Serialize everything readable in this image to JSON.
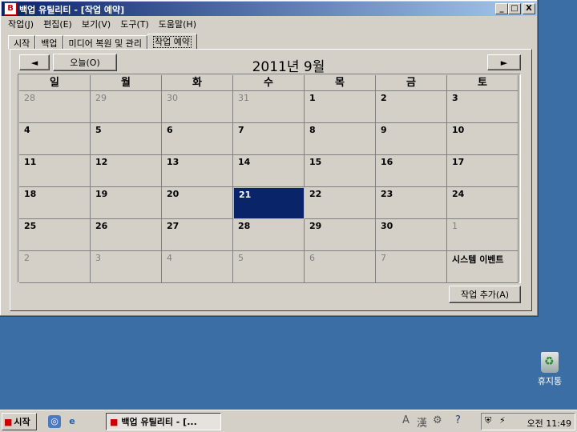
{
  "window": {
    "title": "백업 유틸리티 - [작업 예약]",
    "app_icon_glyph": "B",
    "controls": {
      "minimize": "_",
      "maximize": "□",
      "close": "X"
    }
  },
  "menu": [
    "작업(J)",
    "편집(E)",
    "보기(V)",
    "도구(T)",
    "도움말(H)"
  ],
  "tabs": [
    {
      "label": "시작"
    },
    {
      "label": "백업"
    },
    {
      "label": "미디어 복원 및 관리"
    },
    {
      "label": "작업 예약",
      "active": true
    }
  ],
  "calendar": {
    "prev_label": "◄",
    "next_label": "►",
    "today_label": "오늘(O)",
    "month_title": "2011년 9월",
    "weekdays": [
      "일",
      "월",
      "화",
      "수",
      "목",
      "금",
      "토"
    ],
    "weeks": [
      [
        {
          "d": "28",
          "o": true
        },
        {
          "d": "29",
          "o": true
        },
        {
          "d": "30",
          "o": true
        },
        {
          "d": "31",
          "o": true
        },
        {
          "d": "1"
        },
        {
          "d": "2"
        },
        {
          "d": "3"
        }
      ],
      [
        {
          "d": "4"
        },
        {
          "d": "5"
        },
        {
          "d": "6"
        },
        {
          "d": "7"
        },
        {
          "d": "8"
        },
        {
          "d": "9"
        },
        {
          "d": "10"
        }
      ],
      [
        {
          "d": "11"
        },
        {
          "d": "12"
        },
        {
          "d": "13"
        },
        {
          "d": "14"
        },
        {
          "d": "15"
        },
        {
          "d": "16"
        },
        {
          "d": "17"
        }
      ],
      [
        {
          "d": "18"
        },
        {
          "d": "19"
        },
        {
          "d": "20"
        },
        {
          "d": "21",
          "sel": true
        },
        {
          "d": "22"
        },
        {
          "d": "23"
        },
        {
          "d": "24"
        }
      ],
      [
        {
          "d": "25"
        },
        {
          "d": "26"
        },
        {
          "d": "27"
        },
        {
          "d": "28"
        },
        {
          "d": "29"
        },
        {
          "d": "30"
        },
        {
          "d": "1",
          "o": true
        }
      ],
      [
        {
          "d": "2",
          "o": true
        },
        {
          "d": "3",
          "o": true
        },
        {
          "d": "4",
          "o": true
        },
        {
          "d": "5",
          "o": true
        },
        {
          "d": "6",
          "o": true
        },
        {
          "d": "7",
          "o": true
        },
        {
          "d": "",
          "evt": "시스템 이벤트"
        }
      ]
    ]
  },
  "add_job_label": "작업 추가(A)",
  "desktop": {
    "recycle_bin_label": "휴지통"
  },
  "taskbar": {
    "start_label": "시작",
    "task_label": "백업 유틸리티 - [...",
    "ime_labels": [
      "A",
      "漢"
    ],
    "clock": "오전 11:49"
  },
  "colors": {
    "titlebar": "#0a246a",
    "desktop": "#3a6ea5",
    "selected_day": "#0a246a"
  }
}
